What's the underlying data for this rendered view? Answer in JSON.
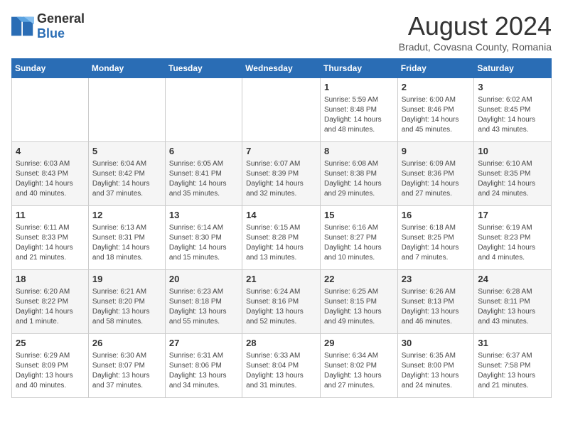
{
  "logo": {
    "general": "General",
    "blue": "Blue"
  },
  "header": {
    "month_year": "August 2024",
    "location": "Bradut, Covasna County, Romania"
  },
  "weekdays": [
    "Sunday",
    "Monday",
    "Tuesday",
    "Wednesday",
    "Thursday",
    "Friday",
    "Saturday"
  ],
  "weeks": [
    [
      {
        "day": "",
        "info": ""
      },
      {
        "day": "",
        "info": ""
      },
      {
        "day": "",
        "info": ""
      },
      {
        "day": "",
        "info": ""
      },
      {
        "day": "1",
        "info": "Sunrise: 5:59 AM\nSunset: 8:48 PM\nDaylight: 14 hours\nand 48 minutes."
      },
      {
        "day": "2",
        "info": "Sunrise: 6:00 AM\nSunset: 8:46 PM\nDaylight: 14 hours\nand 45 minutes."
      },
      {
        "day": "3",
        "info": "Sunrise: 6:02 AM\nSunset: 8:45 PM\nDaylight: 14 hours\nand 43 minutes."
      }
    ],
    [
      {
        "day": "4",
        "info": "Sunrise: 6:03 AM\nSunset: 8:43 PM\nDaylight: 14 hours\nand 40 minutes."
      },
      {
        "day": "5",
        "info": "Sunrise: 6:04 AM\nSunset: 8:42 PM\nDaylight: 14 hours\nand 37 minutes."
      },
      {
        "day": "6",
        "info": "Sunrise: 6:05 AM\nSunset: 8:41 PM\nDaylight: 14 hours\nand 35 minutes."
      },
      {
        "day": "7",
        "info": "Sunrise: 6:07 AM\nSunset: 8:39 PM\nDaylight: 14 hours\nand 32 minutes."
      },
      {
        "day": "8",
        "info": "Sunrise: 6:08 AM\nSunset: 8:38 PM\nDaylight: 14 hours\nand 29 minutes."
      },
      {
        "day": "9",
        "info": "Sunrise: 6:09 AM\nSunset: 8:36 PM\nDaylight: 14 hours\nand 27 minutes."
      },
      {
        "day": "10",
        "info": "Sunrise: 6:10 AM\nSunset: 8:35 PM\nDaylight: 14 hours\nand 24 minutes."
      }
    ],
    [
      {
        "day": "11",
        "info": "Sunrise: 6:11 AM\nSunset: 8:33 PM\nDaylight: 14 hours\nand 21 minutes."
      },
      {
        "day": "12",
        "info": "Sunrise: 6:13 AM\nSunset: 8:31 PM\nDaylight: 14 hours\nand 18 minutes."
      },
      {
        "day": "13",
        "info": "Sunrise: 6:14 AM\nSunset: 8:30 PM\nDaylight: 14 hours\nand 15 minutes."
      },
      {
        "day": "14",
        "info": "Sunrise: 6:15 AM\nSunset: 8:28 PM\nDaylight: 14 hours\nand 13 minutes."
      },
      {
        "day": "15",
        "info": "Sunrise: 6:16 AM\nSunset: 8:27 PM\nDaylight: 14 hours\nand 10 minutes."
      },
      {
        "day": "16",
        "info": "Sunrise: 6:18 AM\nSunset: 8:25 PM\nDaylight: 14 hours\nand 7 minutes."
      },
      {
        "day": "17",
        "info": "Sunrise: 6:19 AM\nSunset: 8:23 PM\nDaylight: 14 hours\nand 4 minutes."
      }
    ],
    [
      {
        "day": "18",
        "info": "Sunrise: 6:20 AM\nSunset: 8:22 PM\nDaylight: 14 hours\nand 1 minute."
      },
      {
        "day": "19",
        "info": "Sunrise: 6:21 AM\nSunset: 8:20 PM\nDaylight: 13 hours\nand 58 minutes."
      },
      {
        "day": "20",
        "info": "Sunrise: 6:23 AM\nSunset: 8:18 PM\nDaylight: 13 hours\nand 55 minutes."
      },
      {
        "day": "21",
        "info": "Sunrise: 6:24 AM\nSunset: 8:16 PM\nDaylight: 13 hours\nand 52 minutes."
      },
      {
        "day": "22",
        "info": "Sunrise: 6:25 AM\nSunset: 8:15 PM\nDaylight: 13 hours\nand 49 minutes."
      },
      {
        "day": "23",
        "info": "Sunrise: 6:26 AM\nSunset: 8:13 PM\nDaylight: 13 hours\nand 46 minutes."
      },
      {
        "day": "24",
        "info": "Sunrise: 6:28 AM\nSunset: 8:11 PM\nDaylight: 13 hours\nand 43 minutes."
      }
    ],
    [
      {
        "day": "25",
        "info": "Sunrise: 6:29 AM\nSunset: 8:09 PM\nDaylight: 13 hours\nand 40 minutes."
      },
      {
        "day": "26",
        "info": "Sunrise: 6:30 AM\nSunset: 8:07 PM\nDaylight: 13 hours\nand 37 minutes."
      },
      {
        "day": "27",
        "info": "Sunrise: 6:31 AM\nSunset: 8:06 PM\nDaylight: 13 hours\nand 34 minutes."
      },
      {
        "day": "28",
        "info": "Sunrise: 6:33 AM\nSunset: 8:04 PM\nDaylight: 13 hours\nand 31 minutes."
      },
      {
        "day": "29",
        "info": "Sunrise: 6:34 AM\nSunset: 8:02 PM\nDaylight: 13 hours\nand 27 minutes."
      },
      {
        "day": "30",
        "info": "Sunrise: 6:35 AM\nSunset: 8:00 PM\nDaylight: 13 hours\nand 24 minutes."
      },
      {
        "day": "31",
        "info": "Sunrise: 6:37 AM\nSunset: 7:58 PM\nDaylight: 13 hours\nand 21 minutes."
      }
    ]
  ]
}
